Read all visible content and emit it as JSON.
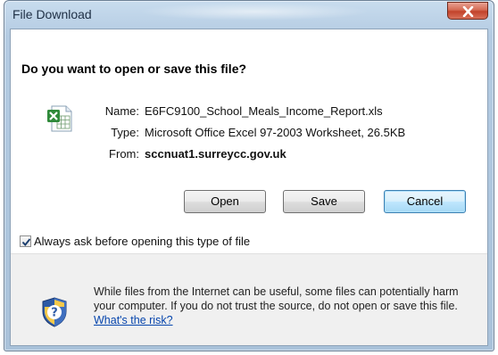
{
  "window": {
    "title": "File Download"
  },
  "dialog": {
    "question": "Do you want to open or save this file?",
    "fields": {
      "name_label": "Name:",
      "name_value": "E6FC9100_School_Meals_Income_Report.xls",
      "type_label": "Type:",
      "type_value": "Microsoft Office Excel 97-2003 Worksheet, 26.5KB",
      "from_label": "From:",
      "from_value": "sccnuat1.surreycc.gov.uk"
    },
    "buttons": {
      "open": "Open",
      "save": "Save",
      "cancel": "Cancel"
    },
    "checkbox": {
      "label": "Always ask before opening this type of file",
      "checked": true
    },
    "warning": {
      "text": "While files from the Internet can be useful, some files can potentially harm your computer. If you do not trust the source, do not open or save this file.",
      "link": "What's the risk?"
    }
  },
  "icons": {
    "file": "excel-file-icon",
    "shield": "security-shield-icon",
    "close": "close-icon"
  },
  "colors": {
    "default_button_border": "#3c7fb1",
    "link": "#0645ad",
    "close_button": "#c2422a"
  }
}
